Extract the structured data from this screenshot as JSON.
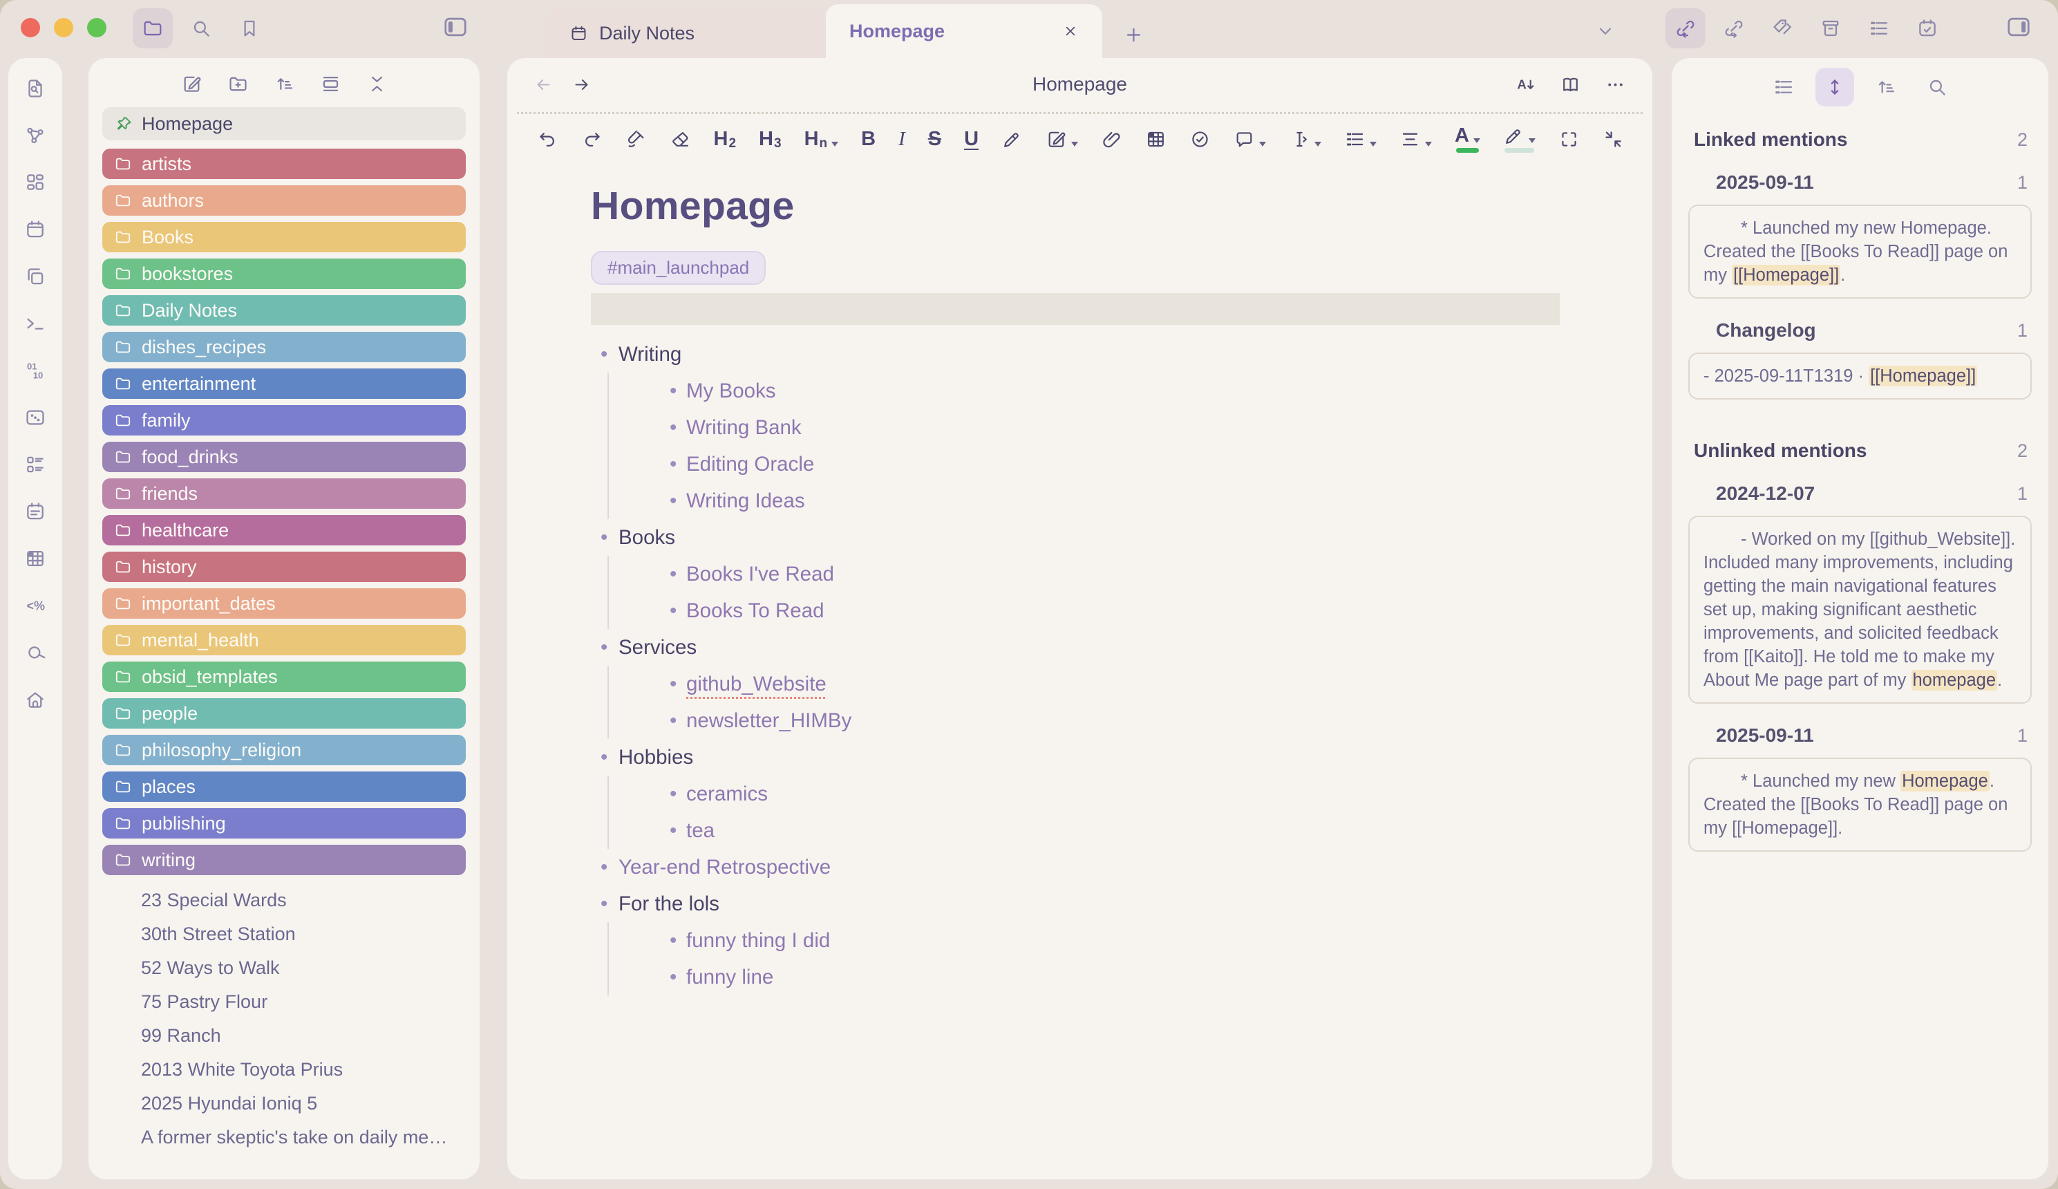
{
  "colors": {
    "accent_purple": "#7b68b0",
    "link_purple": "#8e77b1",
    "text_dark": "#4a4268",
    "text_muted": "#6f6b92",
    "highlight_bg": "#f6e5c3",
    "green_underline": "#3cb65c",
    "pale_underline": "#cfe3da",
    "pin_green": "#4a9e5c",
    "spellcheck_red": "#e8837a",
    "traffic_red": "#ee6a5f",
    "traffic_yellow": "#f5bf4f",
    "traffic_green": "#61c554"
  },
  "window": {
    "controls": [
      "close",
      "minimize",
      "zoom"
    ]
  },
  "header": {
    "left_tools": [
      {
        "name": "files",
        "icon": "folder",
        "active": true
      },
      {
        "name": "search",
        "icon": "search",
        "active": false
      },
      {
        "name": "bookmarks",
        "icon": "bookmark",
        "active": false
      }
    ],
    "right_tools": [
      {
        "name": "backlinks",
        "icon": "link-in",
        "active": true
      },
      {
        "name": "outgoing-links",
        "icon": "link-out",
        "active": false
      },
      {
        "name": "tags",
        "icon": "tags",
        "active": false
      },
      {
        "name": "archive",
        "icon": "archive",
        "active": false
      },
      {
        "name": "outline",
        "icon": "list-ul",
        "active": false
      },
      {
        "name": "daily-note",
        "icon": "calendar-check",
        "active": false
      }
    ]
  },
  "tabs": {
    "items": [
      {
        "label": "Daily Notes",
        "icon": "calendar",
        "active": false,
        "closable": false
      },
      {
        "label": "Homepage",
        "icon": null,
        "active": true,
        "closable": true
      }
    ]
  },
  "ribbon": [
    {
      "name": "file-search",
      "icon": "file-search"
    },
    {
      "name": "graph-view",
      "icon": "graph"
    },
    {
      "name": "workspaces",
      "icon": "layout-grid"
    },
    {
      "name": "calendar",
      "icon": "calendar"
    },
    {
      "name": "duplicate-note",
      "icon": "copy"
    },
    {
      "name": "terminal",
      "icon": "terminal"
    },
    {
      "name": "binary",
      "icon": "binary"
    },
    {
      "name": "random-note",
      "icon": "scan-dots"
    },
    {
      "name": "card-board",
      "icon": "list-blocks"
    },
    {
      "name": "daily-notes",
      "icon": "calendar-days"
    },
    {
      "name": "database",
      "icon": "table-grid"
    },
    {
      "name": "templates",
      "icon": "template"
    },
    {
      "name": "vault-search",
      "icon": "search-slant"
    },
    {
      "name": "home",
      "icon": "home"
    }
  ],
  "sidebar": {
    "tools": [
      {
        "name": "new-note",
        "icon": "edit-square"
      },
      {
        "name": "new-folder",
        "icon": "folder-plus"
      },
      {
        "name": "sort-order",
        "icon": "sort-asc"
      },
      {
        "name": "expand-all",
        "icon": "unfold-rows"
      },
      {
        "name": "collapse-all",
        "icon": "collapse-x"
      }
    ],
    "pinned": {
      "label": "Homepage"
    },
    "folders": [
      {
        "label": "artists",
        "color": "#c87380"
      },
      {
        "label": "authors",
        "color": "#e9a98c"
      },
      {
        "label": "Books",
        "color": "#eac678"
      },
      {
        "label": "bookstores",
        "color": "#6cc288"
      },
      {
        "label": "Daily Notes",
        "color": "#70bcb1"
      },
      {
        "label": "dishes_recipes",
        "color": "#83b1cd"
      },
      {
        "label": "entertainment",
        "color": "#6186c6"
      },
      {
        "label": "family",
        "color": "#7a7ecc"
      },
      {
        "label": "food_drinks",
        "color": "#9a84b5"
      },
      {
        "label": "friends",
        "color": "#bb86a9"
      },
      {
        "label": "healthcare",
        "color": "#b56d9e"
      },
      {
        "label": "history",
        "color": "#c87380"
      },
      {
        "label": "important_dates",
        "color": "#e9a98c"
      },
      {
        "label": "mental_health",
        "color": "#eac678"
      },
      {
        "label": "obsid_templates",
        "color": "#6cc288"
      },
      {
        "label": "people",
        "color": "#70bcb1"
      },
      {
        "label": "philosophy_religion",
        "color": "#83b1cd"
      },
      {
        "label": "places",
        "color": "#6186c6"
      },
      {
        "label": "publishing",
        "color": "#7a7ecc"
      },
      {
        "label": "writing",
        "color": "#9a84b5"
      }
    ],
    "files": [
      "23 Special Wards",
      "30th Street Station",
      "52 Ways to Walk",
      "75 Pastry Flour",
      "99 Ranch",
      "2013 White Toyota Prius",
      "2025 Hyundai Ioniq 5",
      "A former skeptic's take on daily me…"
    ]
  },
  "editor": {
    "title": "Homepage",
    "header_tools": [
      {
        "name": "font-size",
        "icon": "font-down"
      },
      {
        "name": "reading-view",
        "icon": "book-open"
      },
      {
        "name": "more-options",
        "icon": "ellipsis"
      }
    ],
    "toolbar": [
      {
        "name": "undo",
        "icon": "undo"
      },
      {
        "name": "redo",
        "icon": "redo"
      },
      {
        "name": "format-brush",
        "icon": "brush"
      },
      {
        "name": "clear-format",
        "icon": "eraser"
      },
      {
        "name": "heading-2",
        "text": "H",
        "sub": "2"
      },
      {
        "name": "heading-3",
        "text": "H",
        "sub": "3"
      },
      {
        "name": "heading-n",
        "text": "H",
        "sub": "n",
        "caret": true
      },
      {
        "name": "bold",
        "text": "B",
        "style": "bold"
      },
      {
        "name": "italic",
        "text": "I",
        "style": "italic"
      },
      {
        "name": "strikethrough",
        "text": "S",
        "style": "strike"
      },
      {
        "name": "underline",
        "text": "U",
        "style": "under"
      },
      {
        "name": "highlight",
        "icon": "highlighter"
      },
      {
        "name": "insert-callout",
        "icon": "edit-square",
        "caret": true
      },
      {
        "name": "attachment",
        "icon": "paperclip"
      },
      {
        "name": "insert-table",
        "icon": "table-grid"
      },
      {
        "name": "task",
        "icon": "check-circle"
      },
      {
        "name": "comment",
        "icon": "comment",
        "caret": true
      },
      {
        "name": "text-transform",
        "icon": "text-cursor-move",
        "caret": true
      },
      {
        "name": "list-format",
        "icon": "list-ul",
        "caret": true
      },
      {
        "name": "line-spacing",
        "icon": "line-spacing",
        "caret": true
      },
      {
        "name": "text-color",
        "text": "A",
        "underline": "#3cb65c",
        "caret": true
      },
      {
        "name": "highlight-color",
        "icon": "highlighter",
        "underline": "#cfe3da",
        "caret": true
      },
      {
        "name": "fullscreen",
        "icon": "fullscreen"
      },
      {
        "name": "fold",
        "icon": "collapse-diag"
      }
    ],
    "note": {
      "title": "Homepage",
      "tag": "#main_launchpad",
      "items": [
        {
          "label": "Writing",
          "type": "text",
          "children": [
            {
              "label": "My Books"
            },
            {
              "label": "Writing Bank"
            },
            {
              "label": "Editing Oracle"
            },
            {
              "label": "Writing Ideas"
            }
          ]
        },
        {
          "label": "Books",
          "type": "text",
          "children": [
            {
              "label": "Books I've Read"
            },
            {
              "label": "Books To Read"
            }
          ]
        },
        {
          "label": "Services",
          "type": "text",
          "children": [
            {
              "label": "github_Website",
              "misspelled": true
            },
            {
              "label": "newsletter_HIMBy"
            }
          ]
        },
        {
          "label": "Hobbies",
          "type": "text",
          "children": [
            {
              "label": "ceramics"
            },
            {
              "label": "tea"
            }
          ]
        },
        {
          "label": "Year-end Retrospective",
          "type": "link",
          "children": []
        },
        {
          "label": "For the lols",
          "type": "text",
          "children": [
            {
              "label": "funny thing I did"
            },
            {
              "label": "funny line"
            }
          ]
        }
      ]
    }
  },
  "right_panel": {
    "tools": [
      {
        "name": "outline",
        "icon": "list-ul",
        "active": false
      },
      {
        "name": "show-more-context",
        "icon": "arrows-v",
        "active": true
      },
      {
        "name": "sort-results",
        "icon": "sort-asc",
        "active": false
      },
      {
        "name": "search-mentions",
        "icon": "search",
        "active": false
      }
    ],
    "sections": [
      {
        "title": "Linked mentions",
        "count": "2",
        "groups": [
          {
            "title": "2025-09-11",
            "count": "1",
            "indent": true,
            "segments": [
              {
                "t": "* Launched my new Homepage. Created the [[Books To Read]] page on my "
              },
              {
                "t": "[[Homepage]]",
                "hl": true
              },
              {
                "t": "."
              }
            ]
          },
          {
            "title": "Changelog",
            "count": "1",
            "indent": false,
            "segments": [
              {
                "t": "- 2025-09-11T1319 · "
              },
              {
                "t": "[[Homepage]]",
                "hl": true
              }
            ]
          }
        ]
      },
      {
        "title": "Unlinked mentions",
        "count": "2",
        "groups": [
          {
            "title": "2024-12-07",
            "count": "1",
            "indent": true,
            "segments": [
              {
                "t": "- Worked on my [[github_Website]]. Included many improvements, including getting the main navigational features set up, making significant aesthetic improvements, and solicited feedback from [[Kaito]]. He told me to make my About Me page part of my "
              },
              {
                "t": "homepage",
                "hl": true
              },
              {
                "t": "."
              }
            ]
          },
          {
            "title": "2025-09-11",
            "count": "1",
            "indent": true,
            "segments": [
              {
                "t": "* Launched my new "
              },
              {
                "t": "Homepage",
                "hl": true
              },
              {
                "t": ". Created the [[Books To Read]] page on my [[Homepage]]."
              }
            ]
          }
        ]
      }
    ]
  }
}
